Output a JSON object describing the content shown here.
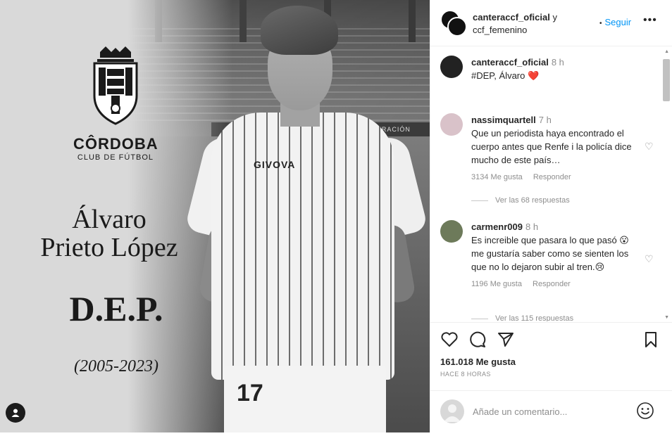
{
  "post": {
    "club_name": "CÔRDOBA",
    "club_subtitle": "CLUB DE FÚTBOL",
    "first_name": "Álvaro",
    "last_name": "Prieto López",
    "dep": "D.E.P.",
    "years": "(2005-2023)",
    "shirt_brand": "GIVOVA",
    "shorts_number": "17",
    "ad_board": "1ª FEDERACIÓN"
  },
  "header": {
    "account1": "canteraccf_oficial",
    "connector": "y",
    "account2": "ccf_femenino",
    "follow_label": "Seguir",
    "follow_dot": "•",
    "more_label": "•••"
  },
  "caption": {
    "user": "canteraccf_oficial",
    "time": "8 h",
    "text": "#DEP, Álvaro ❤️"
  },
  "comments": [
    {
      "user": "nassimquartell",
      "time": "7 h",
      "text": "Que un periodista haya encontrado el cuerpo antes que Renfe i la policía dice mucho de este país…",
      "likes": "3134 Me gusta",
      "reply": "Responder",
      "view_replies": "Ver las 68 respuestas"
    },
    {
      "user": "carmenr009",
      "time": "8 h",
      "text": "Es increible que pasara lo que pasó 😮me gustaría saber como se sienten los que no lo dejaron subir al tren.😢",
      "likes": "1196 Me gusta",
      "reply": "Responder",
      "view_replies": "Ver las 115 respuestas"
    }
  ],
  "actions": {
    "likes": "161.018 Me gusta",
    "ago": "HACE 8 HORAS"
  },
  "add_comment": {
    "placeholder": "Añade un comentario..."
  },
  "icons": {
    "like": "heart-icon",
    "comment": "comment-icon",
    "share": "paper-plane-icon",
    "save": "bookmark-icon",
    "emoji": "smiley-icon",
    "tag": "user-tag-icon"
  },
  "colors": {
    "accent": "#0095f6",
    "text": "#262626",
    "muted": "#8e8e8e",
    "heart_emoji": "#c0392b"
  }
}
